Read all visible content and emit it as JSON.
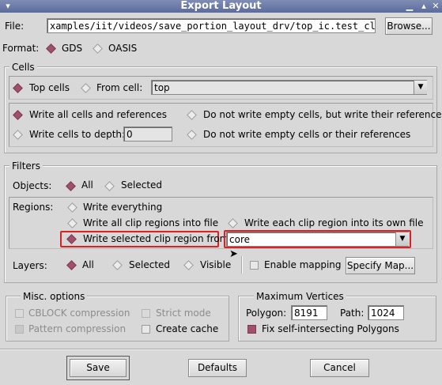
{
  "window": {
    "title": "Export Layout"
  },
  "file": {
    "label": "File:",
    "value": "xamples/iit/videos/save_portion_layout_drv/top_ic.test_clip",
    "browse_label": "Browse..."
  },
  "format": {
    "label": "Format:",
    "options": [
      "GDS",
      "OASIS"
    ],
    "selected": "GDS"
  },
  "cells": {
    "title": "Cells",
    "top_cells_label": "Top cells",
    "from_cell_label": "From cell:",
    "from_cell_value": "top",
    "write_all_label": "Write all cells and references",
    "no_empty_label": "Do not write empty cells, but write their references",
    "depth_label": "Write cells to depth:",
    "depth_value": "0",
    "no_empty_refs_label": "Do not write empty cells or their references"
  },
  "filters": {
    "title": "Filters",
    "objects_label": "Objects:",
    "objects_all": "All",
    "objects_selected": "Selected",
    "regions_label": "Regions:",
    "write_everything": "Write everything",
    "write_all_clip": "Write all clip regions into file",
    "write_each_clip": "Write each clip region into its own file",
    "write_selected_clip": "Write selected clip region from",
    "clip_region_value": "core",
    "layers_label": "Layers:",
    "layers_all": "All",
    "layers_selected": "Selected",
    "layers_visible": "Visible",
    "enable_mapping": "Enable mapping",
    "specify_map": "Specify Map..."
  },
  "misc": {
    "title": "Misc. options",
    "cblock": "CBLOCK compression",
    "strict": "Strict mode",
    "pattern": "Pattern compression",
    "create_cache": "Create cache"
  },
  "maxv": {
    "title": "Maximum Vertices",
    "polygon_label": "Polygon:",
    "polygon_value": "8191",
    "path_label": "Path:",
    "path_value": "1024",
    "fix_label": "Fix self-intersecting Polygons"
  },
  "buttons": {
    "save": "Save",
    "defaults": "Defaults",
    "cancel": "Cancel"
  },
  "colors": {
    "selected_marker": "#a0506a",
    "highlight_box": "#e02020",
    "title_bar": "#6b7aa8"
  }
}
